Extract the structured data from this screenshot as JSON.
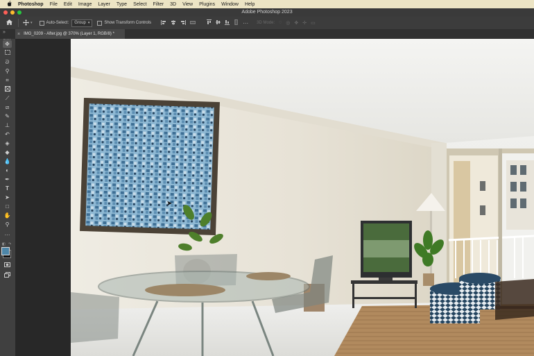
{
  "menubar": {
    "apple": "",
    "app_name": "Photoshop",
    "items": [
      "File",
      "Edit",
      "Image",
      "Layer",
      "Type",
      "Select",
      "Filter",
      "3D",
      "View",
      "Plugins",
      "Window",
      "Help"
    ]
  },
  "window": {
    "title": "Adobe Photoshop 2023"
  },
  "options": {
    "auto_select_label": "Auto-Select:",
    "target_value": "Group",
    "transform_label": "Show Transform Controls",
    "mode_3d": "3D Mode:"
  },
  "document_tab": {
    "label": "IMG_0209 - After.jpg @ 370% (Layer 1, RGB/8) *"
  },
  "colors": {
    "close": "#fe5f57",
    "minimize": "#febc2e",
    "maximize": "#28c840",
    "foreground": "#4d86a8",
    "background": "#111111"
  }
}
